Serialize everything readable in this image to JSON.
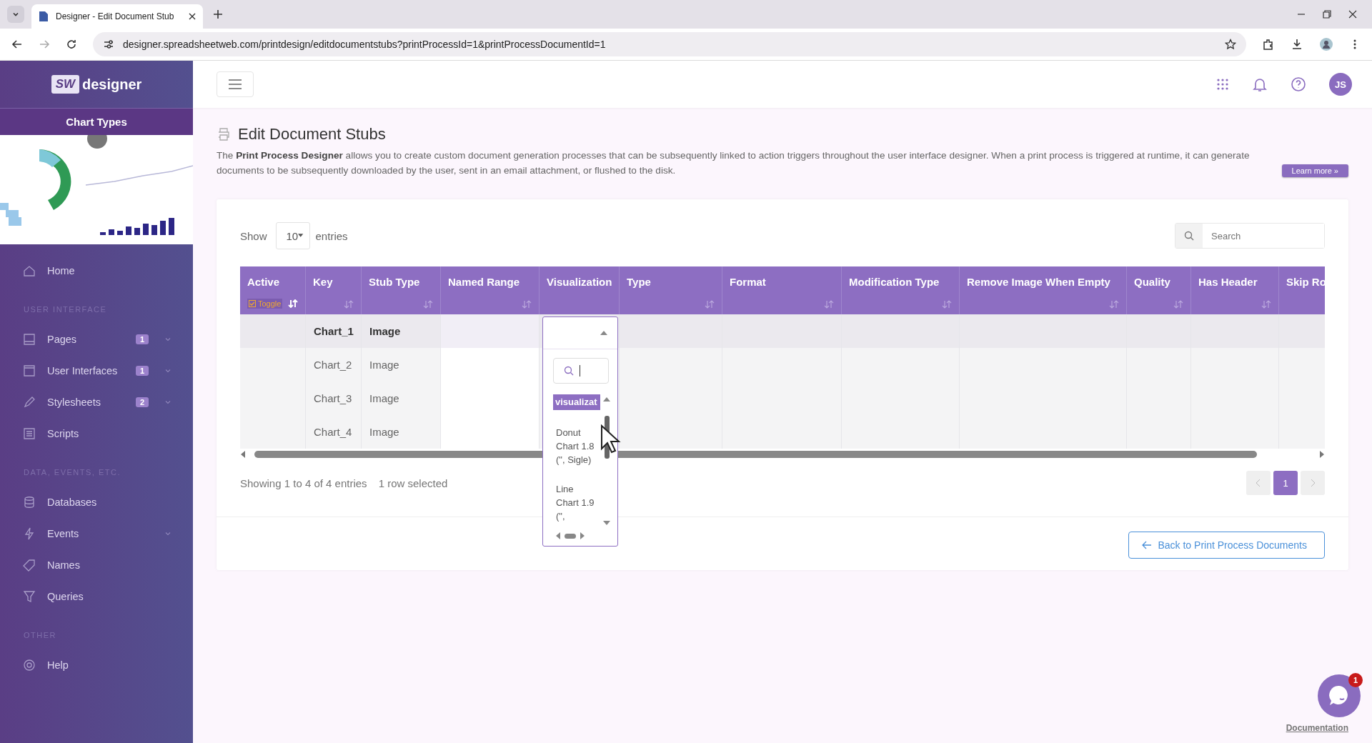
{
  "browser": {
    "tabs": [
      {
        "title": "Designer - Edit Document Stub",
        "selected": true
      }
    ],
    "url": "designer.spreadsheetweb.com/printdesign/editdocumentstubs?printProcessId=1&printProcessDocumentId=1"
  },
  "sidebar": {
    "logo_mark": "SW",
    "logo_text": "designer",
    "panel_title": "Chart Types",
    "sections": [
      {
        "items": [
          {
            "label": "Home",
            "kind": "home",
            "expandable": false
          }
        ]
      },
      {
        "title": "USER INTERFACE",
        "items": [
          {
            "label": "Pages",
            "kind": "page",
            "badge": "1",
            "expandable": true
          },
          {
            "label": "User Interfaces",
            "kind": "window",
            "badge": "1",
            "expandable": true
          },
          {
            "label": "Stylesheets",
            "kind": "pencil",
            "badge": "2",
            "expandable": true
          },
          {
            "label": "Scripts",
            "kind": "script",
            "expandable": false
          }
        ]
      },
      {
        "title": "DATA, EVENTS, ETC.",
        "items": [
          {
            "label": "Databases",
            "kind": "database",
            "expandable": false
          },
          {
            "label": "Events",
            "kind": "bolt",
            "expandable": true
          },
          {
            "label": "Names",
            "kind": "tag",
            "expandable": false
          },
          {
            "label": "Queries",
            "kind": "filter",
            "expandable": false
          }
        ]
      },
      {
        "title": "OTHER",
        "items": [
          {
            "label": "Help",
            "kind": "lifebuoy",
            "expandable": false
          }
        ]
      }
    ]
  },
  "header": {
    "avatar": "JS"
  },
  "page": {
    "title": "Edit Document Stubs",
    "description": "The **Print Process Designer** allows you to create custom document generation processes that can be subsequently linked to action triggers throughout the user interface designer. When a print process is triggered at runtime, it can generate documents to be subsequently downloaded by the user, sent in an email attachment, or flushed to the disk.",
    "learn_more": "Learn more »"
  },
  "table": {
    "show_label": "Show",
    "page_size": "10",
    "entries_label": "entries",
    "search_placeholder": "Search",
    "columns": [
      {
        "label": "Active",
        "sortable": true,
        "sorted": true,
        "toggle": {
          "label": "Toggle",
          "checked": true
        }
      },
      {
        "label": "Key",
        "sortable": true,
        "sorted": false
      },
      {
        "label": "Stub Type",
        "sortable": true,
        "sorted": false
      },
      {
        "label": "Named Range",
        "sortable": true,
        "sorted": false
      },
      {
        "label": "Visualization",
        "sortable": false
      },
      {
        "label": "Type",
        "sortable": true,
        "sorted": false
      },
      {
        "label": "Format",
        "sortable": true,
        "sorted": false
      },
      {
        "label": "Modification Type",
        "sortable": true,
        "sorted": false
      },
      {
        "label": "Remove Image When Empty",
        "sortable": true,
        "sorted": false
      },
      {
        "label": "Quality",
        "sortable": true,
        "sorted": false
      },
      {
        "label": "Has Header",
        "sortable": true,
        "sorted": false
      },
      {
        "label": "Skip Ro"
      }
    ],
    "rows": [
      {
        "key": "Chart_1",
        "stub_type": "Image",
        "selected": true
      },
      {
        "key": "Chart_2",
        "stub_type": "Image",
        "selected": false
      },
      {
        "key": "Chart_3",
        "stub_type": "Image",
        "selected": false
      },
      {
        "key": "Chart_4",
        "stub_type": "Image",
        "selected": false
      }
    ],
    "dropdown": {
      "options": [
        {
          "label": "visualizat",
          "selected": true
        },
        {
          "label": "Donut Chart 1.8 (\", Sigle)",
          "selected": false
        },
        {
          "label": "Line Chart 1.9 (\",",
          "selected": false
        }
      ]
    },
    "info": "Showing 1 to 4 of 4 entries",
    "selection_info": "1 row selected",
    "pages": [
      {
        "label": "1",
        "selected": true
      }
    ]
  },
  "back_button": "Back to Print Process Documents",
  "chat": {
    "badge": "1"
  },
  "footer_link": "Documentation"
}
